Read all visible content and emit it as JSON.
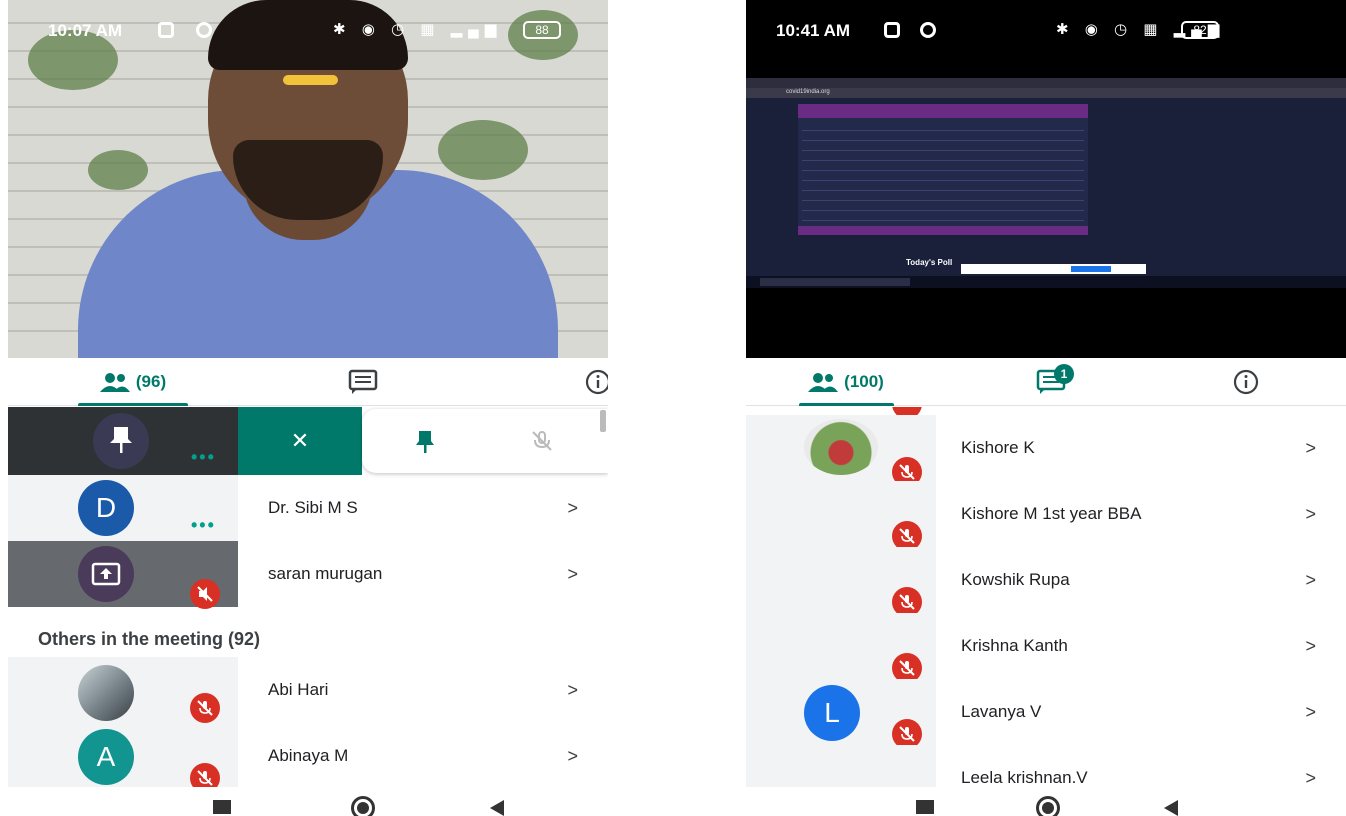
{
  "left": {
    "status": {
      "time": "10:07 AM",
      "battery": "88"
    },
    "tabs": {
      "people": "(96)",
      "chat": "",
      "info": ""
    },
    "pinned_actions": {
      "close": "✕",
      "pin": "",
      "mute": "",
      "remove": ""
    },
    "participants": [
      {
        "name": "Dr. Sibi M S",
        "initial": "D",
        "color": "#1a5aa8"
      },
      {
        "name": "saran murugan",
        "initial": "",
        "color": "#4a3b5a"
      }
    ],
    "others_heading": "Others in the meeting (92)",
    "others": [
      {
        "name": "Abi Hari",
        "initial": "",
        "color": "#8a8f93"
      },
      {
        "name": "Abinaya M",
        "initial": "A",
        "color": "#129490"
      }
    ]
  },
  "right": {
    "status": {
      "time": "10:41 AM",
      "battery": "82"
    },
    "tabs": {
      "people": "(100)",
      "chat_badge": "1"
    },
    "participants": [
      {
        "name": "Kishore K",
        "initial": "",
        "color": "#6a8f5a"
      },
      {
        "name": "Kishore M 1st year BBA",
        "initial": "",
        "color": ""
      },
      {
        "name": "Kowshik Rupa",
        "initial": "",
        "color": ""
      },
      {
        "name": "Krishna Kanth",
        "initial": "",
        "color": ""
      },
      {
        "name": "Lavanya V",
        "initial": "L",
        "color": "#1a73e8"
      },
      {
        "name": "Leela krishnan.V",
        "initial": "",
        "color": ""
      }
    ],
    "shared_screen": {
      "url": "covid19india.org",
      "today_poll": "Today's Poll"
    }
  },
  "colors": {
    "accent": "#00796b",
    "mute_red": "#d93025"
  },
  "icons": {
    "people": "people-icon",
    "chat": "chat-icon",
    "info": "info-icon",
    "mic_off": "mic-off-icon",
    "pin": "pin-icon",
    "present": "present-icon"
  }
}
